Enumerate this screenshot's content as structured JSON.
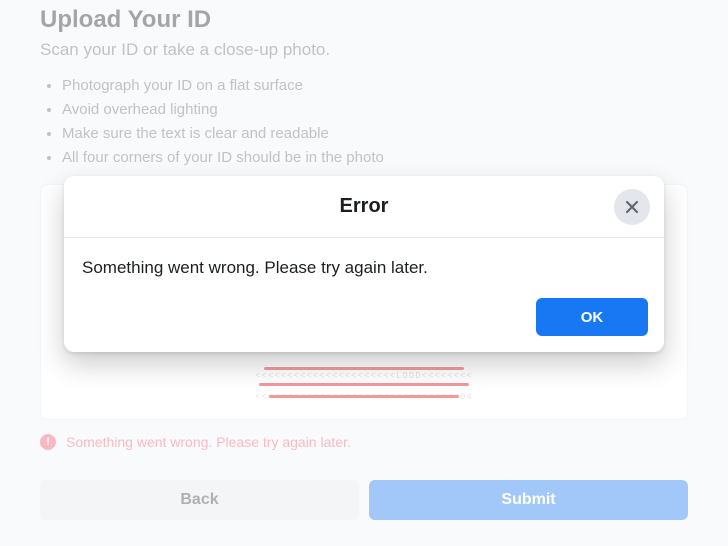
{
  "page": {
    "title": "Upload Your ID",
    "subtitle": "Scan your ID or take a close-up photo.",
    "tips": [
      "Photograph your ID on a flat surface",
      "Avoid overhead lighting",
      "Make sure the text is clear and readable",
      "All four corners of your ID should be in the photo"
    ],
    "inline_error": "Something went wrong. Please try again later.",
    "buttons": {
      "back": "Back",
      "submit": "Submit"
    }
  },
  "modal": {
    "title": "Error",
    "body": "Something went wrong. Please try again later.",
    "ok": "OK"
  },
  "colors": {
    "primary": "#1877f2",
    "error": "#f25268"
  }
}
